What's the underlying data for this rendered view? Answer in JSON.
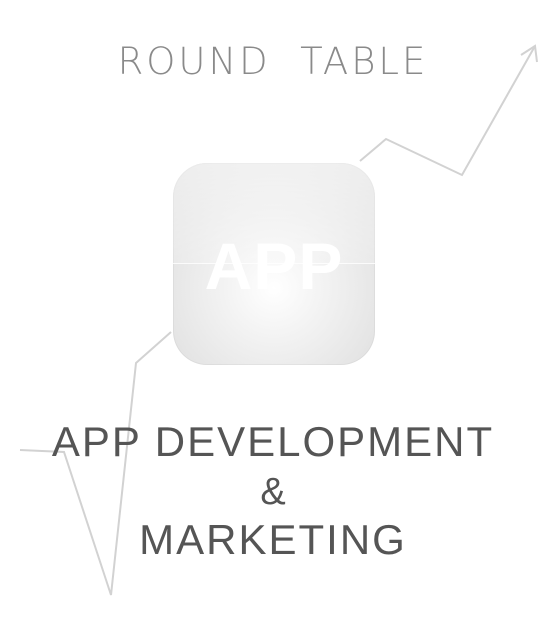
{
  "header": {
    "title": "ROUND  TABLE"
  },
  "app_icon": {
    "label": "APP"
  },
  "headline": {
    "line1": "APP DEVELOPMENT",
    "line2": "&",
    "line3": "MARKETING"
  },
  "colors": {
    "line": "#d2d2d2",
    "title": "#8a8a8a",
    "headline": "#555555",
    "icon_text": "#ffffff"
  },
  "icons": {
    "trend_line": "upward-trend-arrow-icon"
  }
}
